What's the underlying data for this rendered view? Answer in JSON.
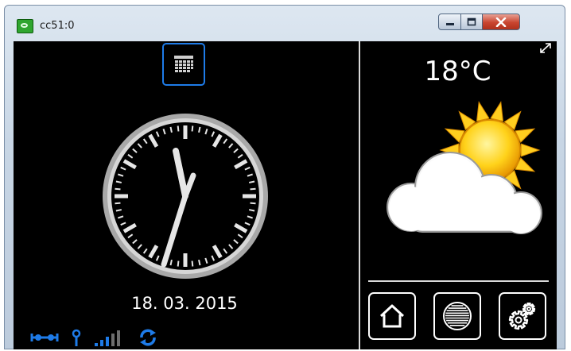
{
  "window": {
    "title": "cc51:0"
  },
  "main": {
    "date": "18. 03. 2015"
  },
  "weather": {
    "temperature": "18°C"
  },
  "colors": {
    "accent": "#1e7be8",
    "screen_bg": "#000000",
    "status_blue": "#1e7be8"
  },
  "icons": {
    "calendar": "calendar-grid-icon",
    "home": "home-icon",
    "fan": "fan-icon",
    "settings": "gear-icon",
    "weather": "sun-behind-cloud-icon"
  }
}
